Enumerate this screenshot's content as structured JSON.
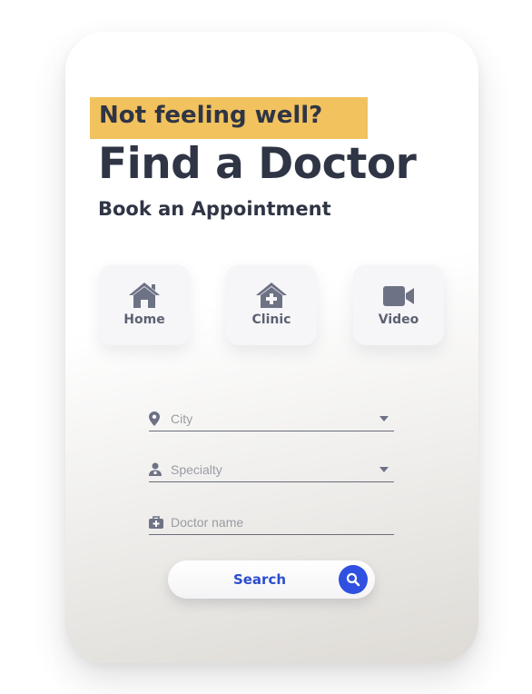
{
  "header": {
    "tagline": "Not feeling well?",
    "title": "Find a Doctor",
    "subtitle": "Book an Appointment"
  },
  "visit_types": [
    {
      "label": "Home",
      "icon": "home-icon"
    },
    {
      "label": "Clinic",
      "icon": "clinic-icon"
    },
    {
      "label": "Video",
      "icon": "video-camera-icon"
    }
  ],
  "form": {
    "city": {
      "placeholder": "City",
      "icon": "map-pin-icon"
    },
    "specialty": {
      "placeholder": "Specialty",
      "icon": "doctor-icon"
    },
    "doctor_name": {
      "placeholder": "Doctor name",
      "icon": "medical-bag-icon"
    }
  },
  "search": {
    "label": "Search",
    "icon": "search-icon"
  },
  "colors": {
    "accent_highlight": "#f1c25e",
    "primary_text": "#2f3545",
    "button_blue": "#2f50e0",
    "icon_gray": "#6e7285"
  }
}
